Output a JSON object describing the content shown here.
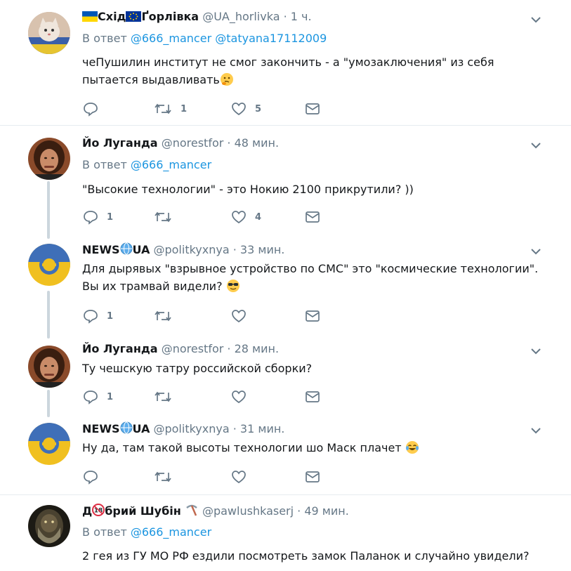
{
  "colors": {
    "accent": "#1b95e0",
    "muted": "#657786",
    "divider": "#e6ecf0",
    "thread": "#ccd6dd"
  },
  "tweets": [
    {
      "name_prefix": "Схід",
      "name_suffix": "Ґорлівка",
      "handle": "@UA_horlivka",
      "sep": "·",
      "time": "1 ч.",
      "reply_prefix": "В ответ",
      "reply_to": [
        "@666_mancer",
        "@tatyana17112009"
      ],
      "text_line1": "чеПушилин институт не смог закончить - а \"умозаключения\" из себя",
      "text_line2": "пытается выдавливать",
      "emoji": "thinking-face-icon",
      "replies": "",
      "retweets": "1",
      "likes": "5"
    },
    {
      "name": "Йо Луганда",
      "handle": "@norestfor",
      "sep": "·",
      "time": "48 мин.",
      "reply_prefix": "В ответ",
      "reply_to": [
        "@666_mancer"
      ],
      "text": "\"Высокие технологии\" - это Нокию 2100 прикрутили? ))",
      "replies": "1",
      "retweets": "",
      "likes": "4"
    },
    {
      "name_prefix": "NEWS",
      "name_suffix": "UA",
      "handle": "@politkyxnya",
      "sep": "·",
      "time": "33 мин.",
      "text_line1": "Для дырявых \"взрывное устройство по СМС\" это \"космические технологии\".",
      "text_line2": "Вы их трамвай видели?",
      "emoji": "sunglasses-face-icon",
      "replies": "1",
      "retweets": "",
      "likes": ""
    },
    {
      "name": "Йо Луганда",
      "handle": "@norestfor",
      "sep": "·",
      "time": "28 мин.",
      "text": "Ту чешскую татру российской сборки?",
      "replies": "1",
      "retweets": "",
      "likes": ""
    },
    {
      "name_prefix": "NEWS",
      "name_suffix": "UA",
      "handle": "@politkyxnya",
      "sep": "·",
      "time": "31 мин.",
      "text": "Ну да, там такой высоты технологии шо Маск плачет",
      "emoji": "tears-of-joy-icon",
      "replies": "",
      "retweets": "",
      "likes": ""
    },
    {
      "name_prefix": "Д",
      "name_suffix": "брий Шубін",
      "handle": "@pawlushkaserj",
      "sep": "·",
      "time": "49 мин.",
      "reply_prefix": "В ответ",
      "reply_to": [
        "@666_mancer"
      ],
      "text": "2 гея из ГУ МО РФ ездили посмотреть замок Паланок и случайно увидели?"
    }
  ]
}
